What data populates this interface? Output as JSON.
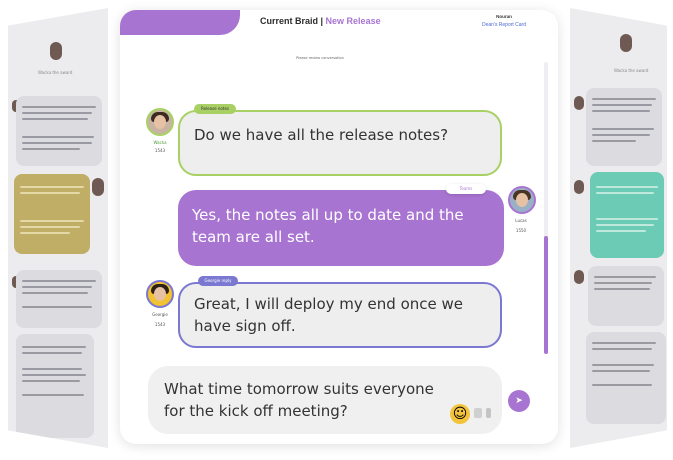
{
  "header": {
    "title_main": "Current Braid",
    "title_sep": " | ",
    "title_accent": "New Release",
    "user_name": "Nouran",
    "user_link": "Dean's Report Card"
  },
  "notice": "Please review conversation",
  "messages": [
    {
      "sender": "Wacka",
      "time": "1543",
      "tag": "Release notes",
      "text": "Do we have all the release notes?"
    },
    {
      "sender": "Lucas",
      "time": "1550",
      "tag": "Teams",
      "text": "Yes, the notes all up to date and the team are all set."
    },
    {
      "sender": "Georgie",
      "time": "1543",
      "tag": "Georgie reply",
      "text": "Great, I will deploy my end once we have sign off."
    }
  ],
  "composer": {
    "text": "What time tomorrow suits everyone for the kick off meeting?",
    "emoji_icon": "smile-emoji-icon",
    "send_icon": "send-icon"
  },
  "left_panel": {
    "caption": "Wacka the award"
  },
  "right_panel": {
    "caption": "Wacka the award"
  },
  "colors": {
    "accent": "#a874d1",
    "green": "#a8d064",
    "indigo": "#7a78d0"
  }
}
